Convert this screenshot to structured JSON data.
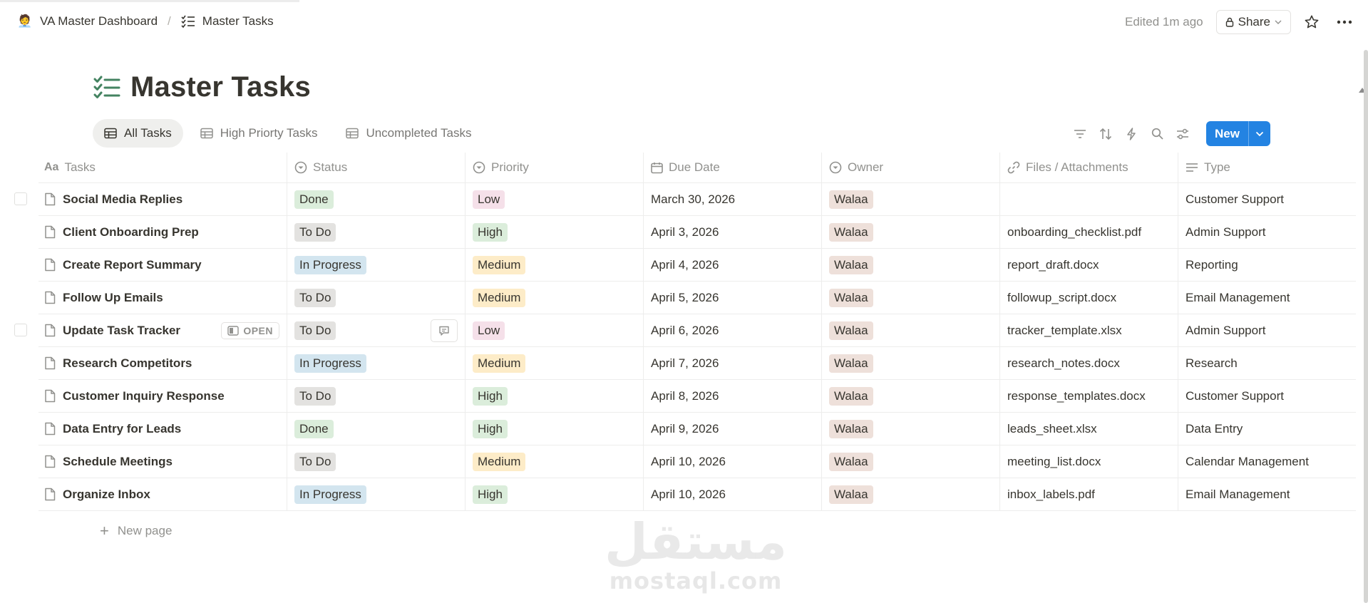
{
  "breadcrumb": {
    "workspace": {
      "emoji": "🧑‍💼",
      "label": "VA Master Dashboard"
    },
    "page": {
      "label": "Master Tasks"
    }
  },
  "topbar": {
    "edited": "Edited 1m ago",
    "share_label": "Share"
  },
  "page": {
    "title": "Master Tasks"
  },
  "views": [
    {
      "label": "All Tasks",
      "active": true
    },
    {
      "label": "High Priorty Tasks",
      "active": false
    },
    {
      "label": "Uncompleted Tasks",
      "active": false
    }
  ],
  "toolbar": {
    "new_label": "New"
  },
  "columns": [
    "Tasks",
    "Status",
    "Priority",
    "Due Date",
    "Owner",
    "Files / Attachments",
    "Type"
  ],
  "colors": {
    "accent": "#2383e2",
    "status": {
      "Done": "#dbeddb",
      "To Do": "#e3e2e0",
      "In Progress": "#d3e5ef"
    },
    "priority": {
      "Low": "#f5e0e9",
      "High": "#dbeddb",
      "Medium": "#fdecc8"
    },
    "owner": "#eee0da"
  },
  "rows": [
    {
      "task": "Social Media Replies",
      "status": "Done",
      "priority": "Low",
      "due": "March 30, 2026",
      "owner": "Walaa",
      "file": "",
      "type": "Customer Support"
    },
    {
      "task": "Client Onboarding Prep",
      "status": "To Do",
      "priority": "High",
      "due": "April 3, 2026",
      "owner": "Walaa",
      "file": "onboarding_checklist.pdf",
      "type": "Admin Support"
    },
    {
      "task": "Create Report Summary",
      "status": "In Progress",
      "priority": "Medium",
      "due": "April 4, 2026",
      "owner": "Walaa",
      "file": "report_draft.docx",
      "type": "Reporting"
    },
    {
      "task": "Follow Up Emails",
      "status": "To Do",
      "priority": "Medium",
      "due": "April 5, 2026",
      "owner": "Walaa",
      "file": "followup_script.docx",
      "type": "Email Management"
    },
    {
      "task": "Update Task Tracker",
      "status": "To Do",
      "priority": "Low",
      "due": "April 6, 2026",
      "owner": "Walaa",
      "file": "tracker_template.xlsx",
      "type": "Admin Support"
    },
    {
      "task": "Research Competitors",
      "status": "In Progress",
      "priority": "Medium",
      "due": "April 7, 2026",
      "owner": "Walaa",
      "file": "research_notes.docx",
      "type": "Research"
    },
    {
      "task": "Customer Inquiry Response",
      "status": "To Do",
      "priority": "High",
      "due": "April 8, 2026",
      "owner": "Walaa",
      "file": "response_templates.docx",
      "type": "Customer Support"
    },
    {
      "task": "Data Entry for Leads",
      "status": "Done",
      "priority": "High",
      "due": "April 9, 2026",
      "owner": "Walaa",
      "file": "leads_sheet.xlsx",
      "type": "Data Entry"
    },
    {
      "task": "Schedule Meetings",
      "status": "To Do",
      "priority": "Medium",
      "due": "April 10, 2026",
      "owner": "Walaa",
      "file": "meeting_list.docx",
      "type": "Calendar Management"
    },
    {
      "task": "Organize Inbox",
      "status": "In Progress",
      "priority": "High",
      "due": "April 10, 2026",
      "owner": "Walaa",
      "file": "inbox_labels.pdf",
      "type": "Email Management"
    }
  ],
  "hover_row": {
    "open_label": "OPEN"
  },
  "new_page_label": "New page",
  "watermark": {
    "arabic": "مستقل",
    "latin": "mostaql.com"
  }
}
